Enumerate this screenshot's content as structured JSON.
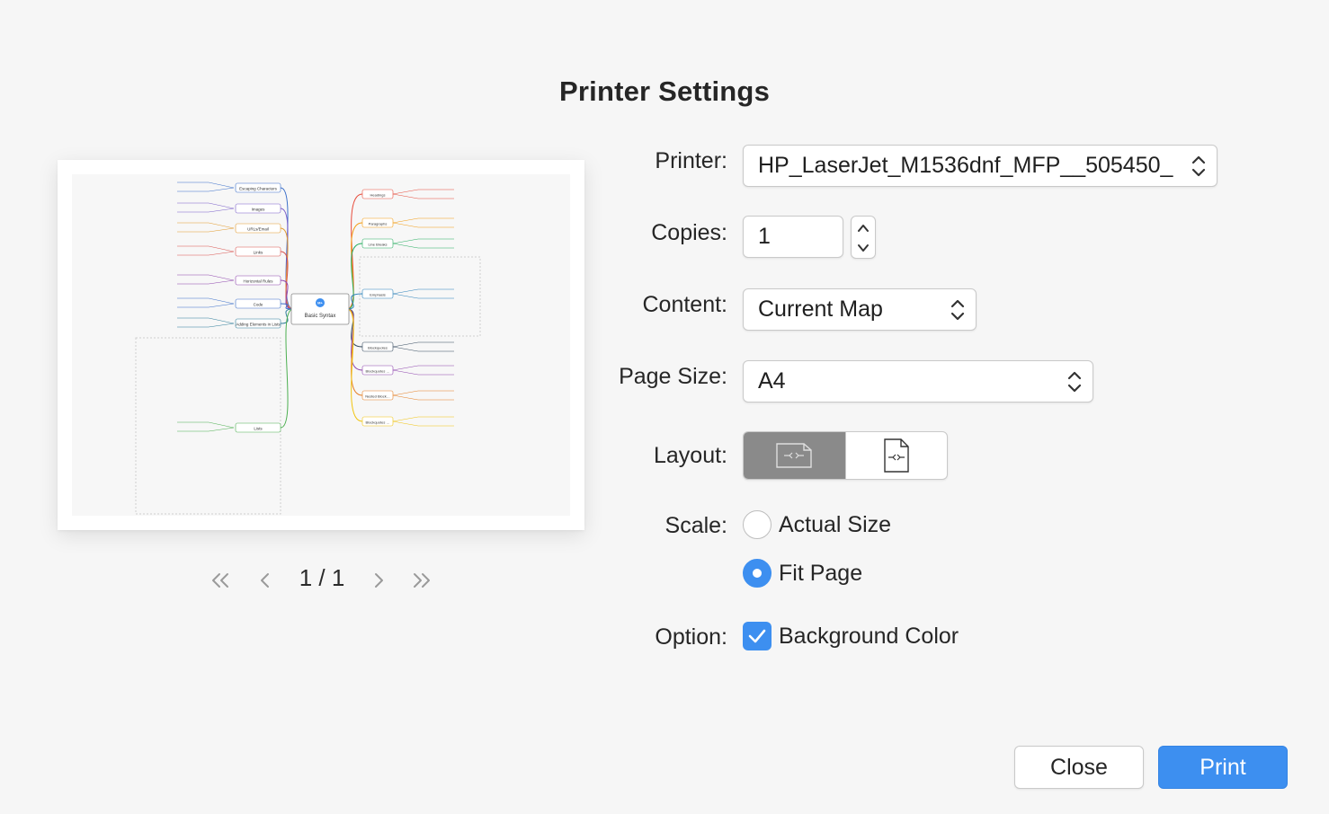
{
  "dialog": {
    "title": "Printer Settings"
  },
  "preview": {
    "page_indicator": "1 / 1",
    "map": {
      "center_title": "Basic Syntax",
      "center_logo": "M+",
      "left_nodes": [
        "Escaping Characters",
        "Images",
        "URLs/Email",
        "Links",
        "Horizontal Rules",
        "Code",
        "Adding Elements in Lists",
        "Lists"
      ],
      "right_nodes": [
        "Headings",
        "Paragraphs",
        "Line Breaks",
        "Emphasis",
        "Blockquotes",
        "Blockquotes & Multiple Paragraphs",
        "Nested Blockquotes",
        "Blockquotes & Other Elements"
      ]
    }
  },
  "form": {
    "printer": {
      "label": "Printer:",
      "value": "HP_LaserJet_M1536dnf_MFP__505450_"
    },
    "copies": {
      "label": "Copies:",
      "value": "1"
    },
    "content": {
      "label": "Content:",
      "value": "Current Map"
    },
    "page_size": {
      "label": "Page Size:",
      "value": "A4"
    },
    "layout": {
      "label": "Layout:",
      "selected": "landscape",
      "options": [
        "landscape",
        "portrait"
      ]
    },
    "scale": {
      "label": "Scale:",
      "options": [
        "Actual Size",
        "Fit Page"
      ],
      "selected": "Fit Page"
    },
    "option": {
      "label": "Option:",
      "checkbox_label": "Background Color",
      "checked": true
    }
  },
  "buttons": {
    "close": "Close",
    "print": "Print"
  },
  "colors": {
    "accent": "#3d8ff0",
    "segment_selected": "#8a8a8a"
  }
}
